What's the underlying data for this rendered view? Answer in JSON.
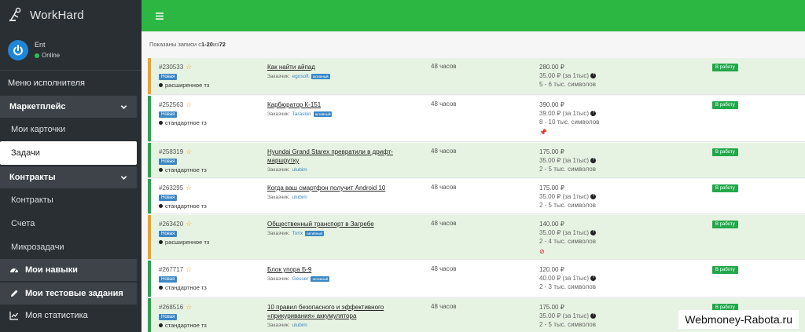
{
  "brand": {
    "name": "WorkHard"
  },
  "user": {
    "name": "Ent",
    "status": "Online"
  },
  "sidebar": {
    "section_title": "Меню исполнителя",
    "marketplace": {
      "label": "Маркетплейс",
      "items": [
        "Мои карточки",
        "Задачи"
      ]
    },
    "contracts": {
      "label": "Контракты",
      "items": [
        "Контракты",
        "Счета"
      ]
    },
    "microtasks": "Микрозадачи",
    "skills": "Мои навыки",
    "tests": "Мои тестовые задания",
    "stats": "Моя статистика"
  },
  "summary": {
    "prefix": "Показаны записи с ",
    "range": "1-20",
    "mid": " из ",
    "total": "72"
  },
  "colors": {
    "topbar": "#2bb741",
    "orange_bar": "#f0a321",
    "green_bar": "#22a84a",
    "badge_blue": "#3a87c5"
  },
  "tasks": [
    {
      "id": "#230533",
      "badge": "Новая",
      "tz": "расширенное тз",
      "title": "Как найти айпад",
      "customer_label": "Заказчик:",
      "customer": "egosoft",
      "customer_badge": "активный",
      "time": "48 часов",
      "price": "280.00 ₽",
      "rate": "35.00 ₽ (за 1тыс)",
      "volume": "5 - 6 тыс. символов",
      "status": "В работу",
      "bar": "orange"
    },
    {
      "id": "#252563",
      "badge": "Новая",
      "tz": "стандартное тз",
      "title": "Карбюратор К-151",
      "customer_label": "Заказчик:",
      "customer": "Taraskin",
      "customer_badge": "активный",
      "time": "48 часов",
      "price": "390.00 ₽",
      "rate": "39.00 ₽ (за 1тыс)",
      "volume": "8 - 10 тыс. символов",
      "status": "В работу",
      "bar": "green"
    },
    {
      "id": "#258319",
      "badge": "Новая",
      "tz": "стандартное тз",
      "title": "Hyundai Grand Starex превратили в дрифт-маршрутку",
      "customer_label": "Заказчик:",
      "customer": "ulubim",
      "customer_badge": "",
      "time": "48 часов",
      "price": "175.00 ₽",
      "rate": "35.00 ₽ (за 1тыс)",
      "volume": "2 - 5 тыс. символов",
      "status": "В работу",
      "bar": "green"
    },
    {
      "id": "#263295",
      "badge": "Новая",
      "tz": "стандартное тз",
      "title": "Когда ваш смартфон получит Android 10",
      "customer_label": "Заказчик:",
      "customer": "ulubim",
      "customer_badge": "",
      "time": "48 часов",
      "price": "175.00 ₽",
      "rate": "35.00 ₽ (за 1тыс)",
      "volume": "2 - 5 тыс. символов",
      "status": "В работу",
      "bar": "green"
    },
    {
      "id": "#263420",
      "badge": "Новая",
      "tz": "расширенное тз",
      "title": "Общественный транспорт в Загребе",
      "customer_label": "Заказчик:",
      "customer": "Torix",
      "customer_badge": "активный",
      "time": "48 часов",
      "price": "140.00 ₽",
      "rate": "35.00 ₽ (за 1тыс)",
      "volume": "2 - 4 тыс. символов",
      "status": "В работу",
      "bar": "orange"
    },
    {
      "id": "#267717",
      "badge": "Новая",
      "tz": "стандартное тз",
      "title": "Блок упора Б-9",
      "customer_label": "Заказчик:",
      "customer": "Gesser",
      "customer_badge": "активный",
      "time": "48 часов",
      "price": "120.00 ₽",
      "rate": "40.00 ₽ (за 1тыс)",
      "volume": "2 - 3 тыс. символов",
      "status": "В работу",
      "bar": "green"
    },
    {
      "id": "#268516",
      "badge": "Новая",
      "tz": "стандартное тз",
      "title": "10 правил безопасного и эффективного «прикуривания» аккумулятора",
      "customer_label": "Заказчик:",
      "customer": "ulubim",
      "customer_badge": "",
      "time": "48 часов",
      "price": "175.00 ₽",
      "rate": "35.00 ₽ (за 1тыс)",
      "volume": "2 - 5 тыс. символов",
      "status": "В работу",
      "bar": "green"
    }
  ],
  "watermark": "Webmoney-Rabota.ru"
}
